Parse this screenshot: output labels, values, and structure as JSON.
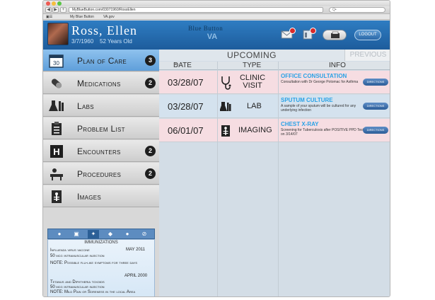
{
  "browser": {
    "url": "MyBlueButton.com/03071960/RossEllen",
    "search_placeholder": "Q•",
    "bookmark_1": "My Blue Button",
    "bookmark_2": "VA.gov"
  },
  "patient": {
    "name": "Ross, Ellen",
    "dob": "3/7/1960",
    "age": "52 Years Old"
  },
  "header": {
    "brand": "Blue Button",
    "logo_text": "VA",
    "logout_label": "LOGOUT"
  },
  "sidebar": {
    "items": [
      {
        "label": "Plan of Care",
        "badge": "3",
        "icon": "calendar-icon"
      },
      {
        "label": "Medications",
        "badge": "2",
        "icon": "pill-icon"
      },
      {
        "label": "Labs",
        "badge": "",
        "icon": "lab-flask-icon"
      },
      {
        "label": "Problem List",
        "badge": "",
        "icon": "clipboard-icon"
      },
      {
        "label": "Encounters",
        "badge": "2",
        "icon": "hospital-icon"
      },
      {
        "label": "Procedures",
        "badge": "2",
        "icon": "procedure-icon"
      },
      {
        "label": "Images",
        "badge": "",
        "icon": "xray-icon"
      }
    ]
  },
  "immunizations": {
    "title": "IMMUNIZATIONS",
    "entries": [
      {
        "name": "Influenza virus vaccine",
        "date": "MAY 2011",
        "dose": "50 mcg intramuscular injection",
        "note": "NOTE: Possible flu-like symptoms for three days"
      },
      {
        "name": "Tetanus and Diphtheria toxoids",
        "date": "APRIL 2000",
        "dose": "50 mcg intramuscular injection",
        "note": "NOTE: Mild Pain or Soreness in the local Area"
      }
    ]
  },
  "main": {
    "tab_upcoming": "UPCOMING",
    "tab_previous": "PREVIOUS",
    "col_date": "DATE",
    "col_type": "TYPE",
    "col_info": "INFO",
    "rows": [
      {
        "date": "03/28/07",
        "type_line1": "CLINIC",
        "type_line2": "VISIT",
        "title": "OFFICE CONSULTATION",
        "desc": "Consultation with Dr George Potomac for Asthma",
        "button": "DIRECTIONS"
      },
      {
        "date": "03/28/07",
        "type_line1": "LAB",
        "type_line2": "",
        "title": "SPUTUM CULTURE",
        "desc": "A sample of your sputum will be cultured for any underlying infection",
        "button": "DIRECTIONS"
      },
      {
        "date": "06/01/07",
        "type_line1": "IMAGING",
        "type_line2": "",
        "title": "CHEST X-RAY",
        "desc": "Screening for Tuberculosis after POSITIVE PPD Test on 3/14/07",
        "button": "DIRECTIONS"
      }
    ]
  },
  "colors": {
    "header_blue": "#2f7dc2",
    "active_nav": "#7ab3e6",
    "info_title": "#2aa2e6",
    "alert_red": "#d82a2a"
  }
}
